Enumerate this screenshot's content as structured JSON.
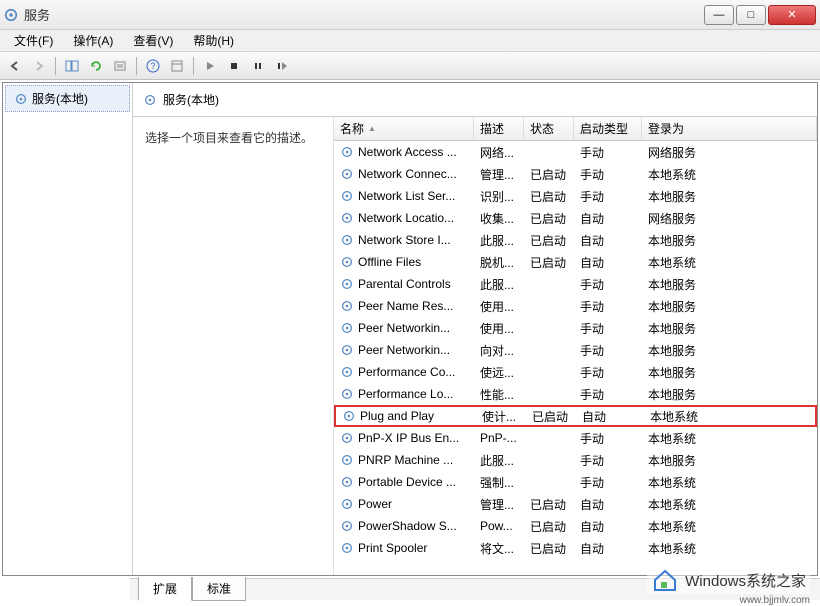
{
  "titlebar": {
    "title": "服务"
  },
  "menubar": {
    "items": [
      "文件(F)",
      "操作(A)",
      "查看(V)",
      "帮助(H)"
    ]
  },
  "left_pane": {
    "root_label": "服务(本地)"
  },
  "right_header": {
    "title": "服务(本地)"
  },
  "desc_pane": {
    "prompt": "选择一个项目来查看它的描述。"
  },
  "columns": {
    "name": "名称",
    "desc": "描述",
    "status": "状态",
    "start": "启动类型",
    "logon": "登录为"
  },
  "services": [
    {
      "name": "Network Access ...",
      "desc": "网络...",
      "status": "",
      "start": "手动",
      "logon": "网络服务"
    },
    {
      "name": "Network Connec...",
      "desc": "管理...",
      "status": "已启动",
      "start": "手动",
      "logon": "本地系统"
    },
    {
      "name": "Network List Ser...",
      "desc": "识别...",
      "status": "已启动",
      "start": "手动",
      "logon": "本地服务"
    },
    {
      "name": "Network Locatio...",
      "desc": "收集...",
      "status": "已启动",
      "start": "自动",
      "logon": "网络服务"
    },
    {
      "name": "Network Store I...",
      "desc": "此服...",
      "status": "已启动",
      "start": "自动",
      "logon": "本地服务"
    },
    {
      "name": "Offline Files",
      "desc": "脱机...",
      "status": "已启动",
      "start": "自动",
      "logon": "本地系统"
    },
    {
      "name": "Parental Controls",
      "desc": "此服...",
      "status": "",
      "start": "手动",
      "logon": "本地服务"
    },
    {
      "name": "Peer Name Res...",
      "desc": "使用...",
      "status": "",
      "start": "手动",
      "logon": "本地服务"
    },
    {
      "name": "Peer Networkin...",
      "desc": "使用...",
      "status": "",
      "start": "手动",
      "logon": "本地服务"
    },
    {
      "name": "Peer Networkin...",
      "desc": "向对...",
      "status": "",
      "start": "手动",
      "logon": "本地服务"
    },
    {
      "name": "Performance Co...",
      "desc": "使远...",
      "status": "",
      "start": "手动",
      "logon": "本地服务"
    },
    {
      "name": "Performance Lo...",
      "desc": "性能...",
      "status": "",
      "start": "手动",
      "logon": "本地服务"
    },
    {
      "name": "Plug and Play",
      "desc": "使计...",
      "status": "已启动",
      "start": "自动",
      "logon": "本地系统",
      "highlight": true
    },
    {
      "name": "PnP-X IP Bus En...",
      "desc": "PnP-...",
      "status": "",
      "start": "手动",
      "logon": "本地系统"
    },
    {
      "name": "PNRP Machine ...",
      "desc": "此服...",
      "status": "",
      "start": "手动",
      "logon": "本地服务"
    },
    {
      "name": "Portable Device ...",
      "desc": "强制...",
      "status": "",
      "start": "手动",
      "logon": "本地系统"
    },
    {
      "name": "Power",
      "desc": "管理...",
      "status": "已启动",
      "start": "自动",
      "logon": "本地系统"
    },
    {
      "name": "PowerShadow S...",
      "desc": "Pow...",
      "status": "已启动",
      "start": "自动",
      "logon": "本地系统"
    },
    {
      "name": "Print Spooler",
      "desc": "将文...",
      "status": "已启动",
      "start": "自动",
      "logon": "本地系统"
    }
  ],
  "tabs": {
    "extended": "扩展",
    "standard": "标准"
  },
  "watermark": {
    "text": "Windows系统之家",
    "url": "www.bjjmlv.com"
  }
}
